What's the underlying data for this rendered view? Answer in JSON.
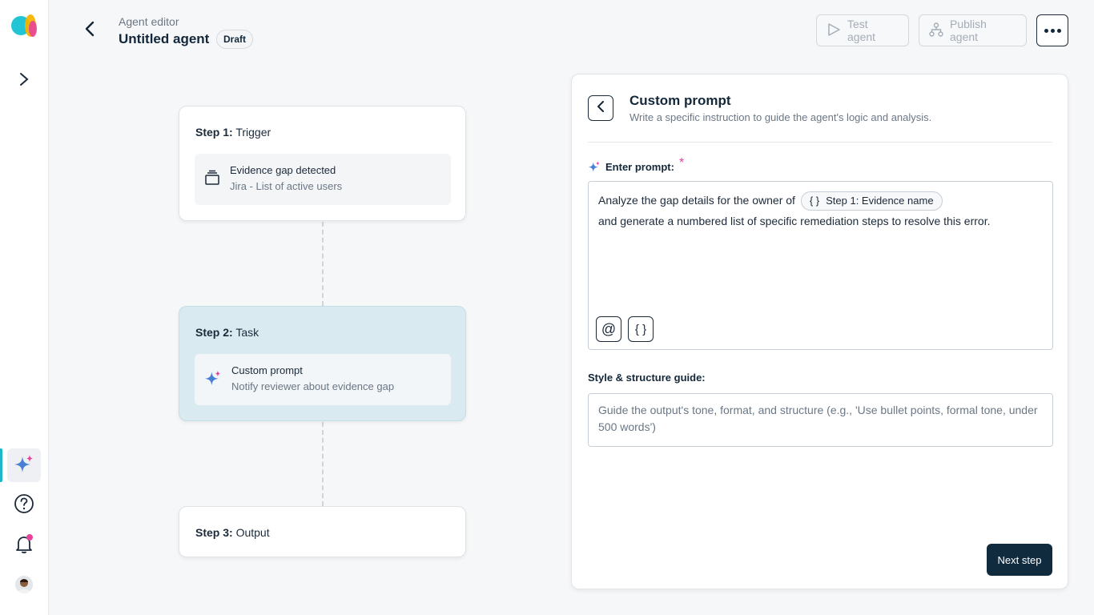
{
  "header": {
    "breadcrumb": "Agent editor",
    "title": "Untitled agent",
    "status_badge": "Draft",
    "test_label": "Test agent",
    "publish_label": "Publish agent"
  },
  "steps": [
    {
      "label_bold": "Step 1:",
      "label_rest": " Trigger",
      "item_title": "Evidence gap detected",
      "item_sub": "Jira - List of active users",
      "icon": "stack-icon"
    },
    {
      "label_bold": "Step 2:",
      "label_rest": " Task",
      "item_title": "Custom prompt",
      "item_sub": "Notify reviewer about evidence gap",
      "icon": "sparkle-icon"
    },
    {
      "label_bold": "Step 3:",
      "label_rest": " Output"
    }
  ],
  "panel": {
    "title": "Custom prompt",
    "subtitle": "Write a specific instruction to guide the agent's logic and analysis.",
    "prompt_label": "Enter prompt:",
    "required_mark": "*",
    "prompt_text_before": "Analyze the gap details for the owner of",
    "prompt_chip_glyph": "{ }",
    "prompt_chip": "Step 1: Evidence name",
    "prompt_text_after": "and generate a numbered list of specific remediation steps to resolve this error.",
    "mention_glyph": "@",
    "variable_glyph": "{ }",
    "style_label": "Style & structure guide:",
    "style_placeholder": "Guide the output's tone, format, and structure (e.g., 'Use bullet points, formal tone, under 500 words')",
    "next_label": "Next step"
  },
  "colors": {
    "accent": "#1bb8c9",
    "primary_button": "#0f2b3d",
    "active_step": "#d9ebf0",
    "required": "#e8439a"
  }
}
